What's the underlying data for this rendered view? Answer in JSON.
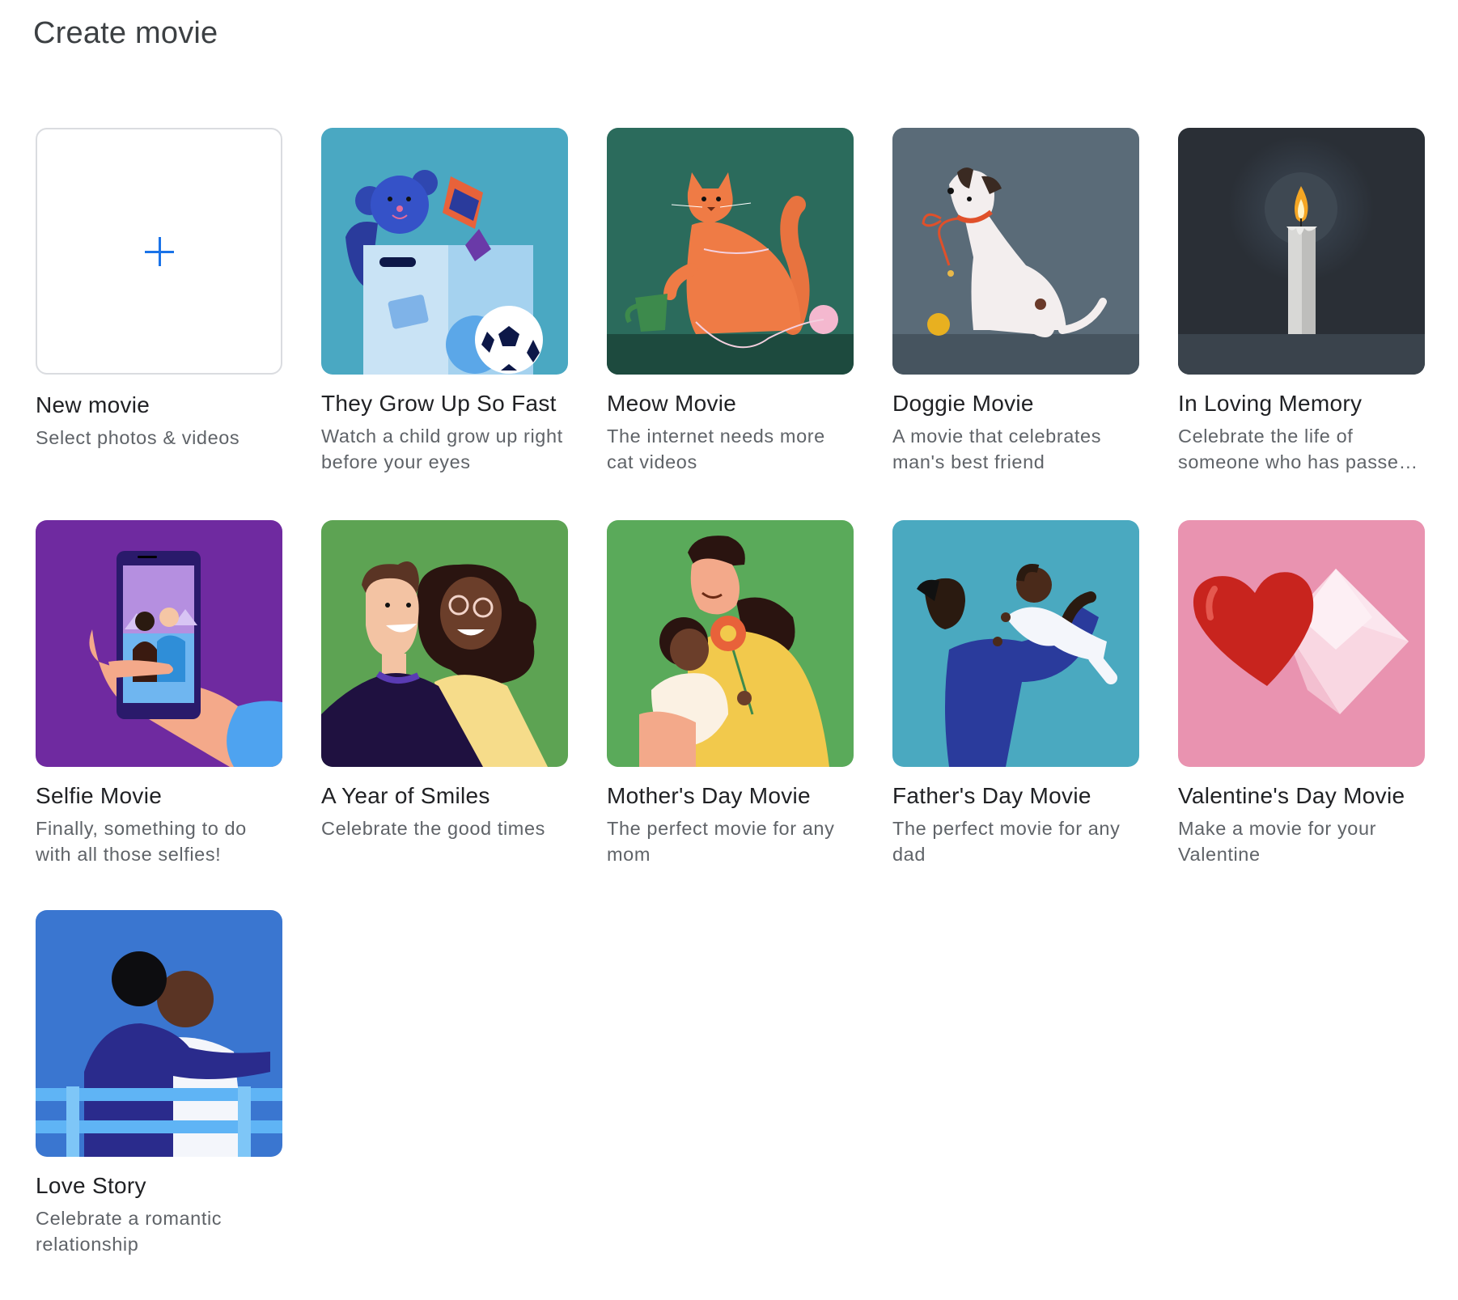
{
  "page": {
    "title": "Create movie"
  },
  "cards": [
    {
      "title": "New movie",
      "description": "Select photos & videos",
      "illustration": "plus-icon",
      "color": "#1a73e8"
    },
    {
      "title": "They Grow Up So Fast",
      "description": "Watch a child grow up right before your eyes",
      "illustration": "toy-box-illustration",
      "color": "#4aa8c2"
    },
    {
      "title": "Meow Movie",
      "description": "The internet needs more cat videos",
      "illustration": "cat-illustration",
      "color": "#2b6b5c"
    },
    {
      "title": "Doggie Movie",
      "description": "A movie that celebrates man's best friend",
      "illustration": "dog-illustration",
      "color": "#5a6b78"
    },
    {
      "title": "In Loving Memory",
      "description": "Celebrate the life of someone who has passed away",
      "illustration": "candle-illustration",
      "color": "#2a2f36"
    },
    {
      "title": "Selfie Movie",
      "description": "Finally, something to do with all those selfies!",
      "illustration": "selfie-phone-illustration",
      "color": "#6f2aa0"
    },
    {
      "title": "A Year of Smiles",
      "description": "Celebrate the good times",
      "illustration": "smiling-couple-illustration",
      "color": "#5da353"
    },
    {
      "title": "Mother's Day Movie",
      "description": "The perfect movie for any mom",
      "illustration": "mother-child-illustration",
      "color": "#5aaa5a"
    },
    {
      "title": "Father's Day Movie",
      "description": "The perfect movie for any dad",
      "illustration": "father-baby-illustration",
      "color": "#4aa9c0"
    },
    {
      "title": "Valentine's Day Movie",
      "description": "Make a movie for your Valentine",
      "illustration": "heart-envelope-illustration",
      "color": "#e993b0"
    },
    {
      "title": "Love Story",
      "description": "Celebrate a romantic relationship",
      "illustration": "couple-bench-illustration",
      "color": "#3a76d0"
    }
  ]
}
